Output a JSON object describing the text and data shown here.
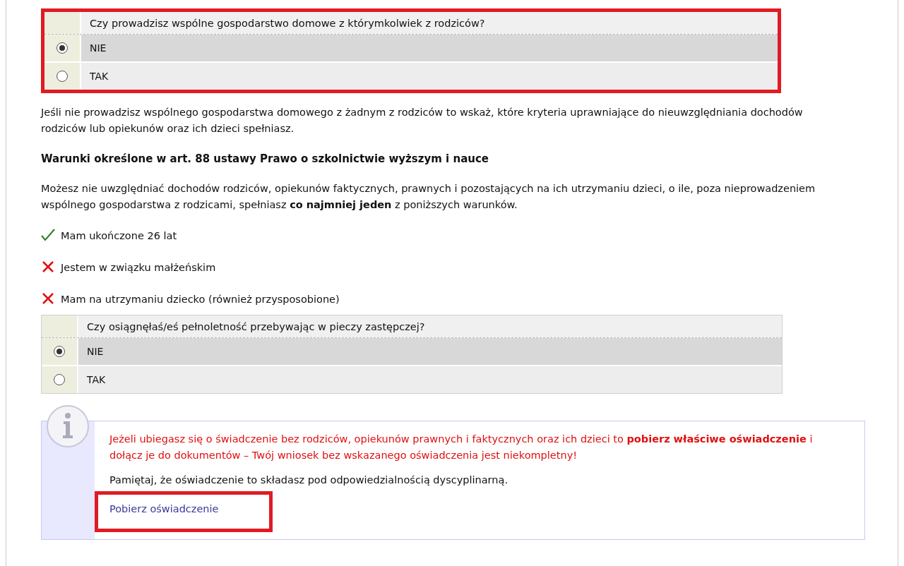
{
  "questions": [
    {
      "question": "Czy prowadzisz wspólne gospodarstwo domowe z którymkolwiek z rodziców?",
      "highlighted": true,
      "options": [
        {
          "label": "NIE",
          "selected": true
        },
        {
          "label": "TAK",
          "selected": false
        }
      ]
    }
  ],
  "intro": "Jeśli nie prowadzisz wspólnego gospodarstwa domowego z żadnym z rodziców to wskaż, które kryteria uprawniające do nieuwzględniania dochodów rodziców lub opiekunów oraz ich dzieci spełniasz.",
  "heading": "Warunki określone w art. 88 ustawy Prawo o szkolnictwie wyższym i nauce",
  "description": "Możesz nie uwzględniać dochodów rodziców, opiekunów faktycznych, prawnych i pozostających na ich utrzymaniu dzieci, o ile, poza nieprowadzeniem wspólnego gospodarstwa z rodzicami, spełniasz **co najmniej jeden** z poniższych warunków.",
  "conditions": [
    {
      "label": "Mam ukończone 26 lat",
      "met": true
    },
    {
      "label": "Jestem w związku małżeńskim",
      "met": false
    },
    {
      "label": "Mam na utrzymaniu dziecko (również przysposobione)",
      "met": false
    }
  ],
  "question_2": {
    "question": "Czy osiągnęłaś/eś pełnoletność przebywając w pieczy zastępczej?",
    "highlighted": false,
    "options": [
      {
        "label": "NIE",
        "selected": true
      },
      {
        "label": "TAK",
        "selected": false
      }
    ]
  },
  "info": {
    "warning": "Jeżeli ubiegasz się o świadczenie bez rodziców, opiekunów prawnych i faktycznych oraz ich dzieci to **pobierz właściwe oświadczenie** i dołącz je do dokumentów – Twój wniosek bez wskazanego oświadczenia jest niekompletny!",
    "note": "Pamiętaj, że oświadczenie to składasz pod odpowiedzialnością dyscyplinarną.",
    "link": {
      "label": "Pobierz oświadczenie",
      "highlighted": true
    }
  }
}
